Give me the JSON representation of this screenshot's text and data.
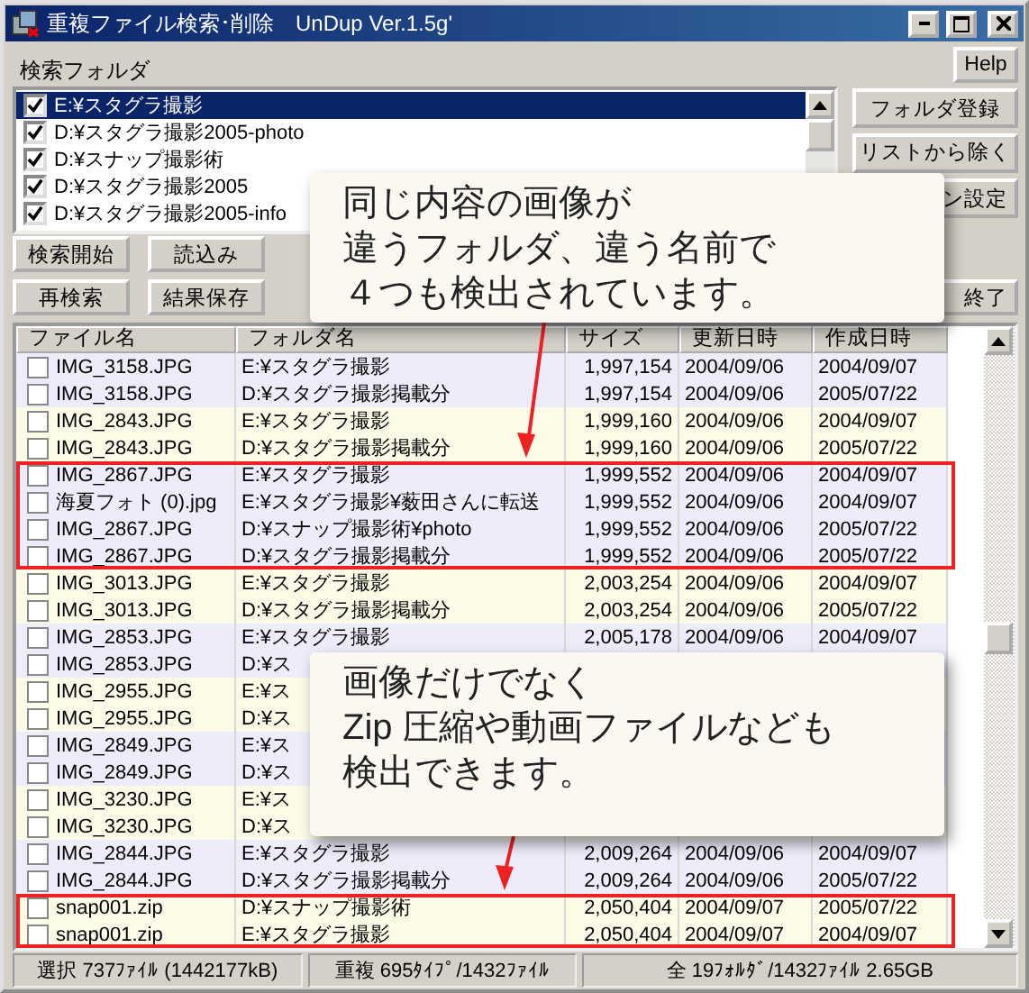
{
  "window": {
    "title": "重複ファイル検索･削除　UnDup Ver.1.5g'"
  },
  "folder_label": "検索フォルダ",
  "help_button": "Help",
  "folders": [
    {
      "path": "E:¥スタグラ撮影",
      "checked": true,
      "selected": true
    },
    {
      "path": "D:¥スタグラ撮影2005-photo",
      "checked": true,
      "selected": false
    },
    {
      "path": "D:¥スナップ撮影術",
      "checked": true,
      "selected": false
    },
    {
      "path": "D:¥スタグラ撮影2005",
      "checked": true,
      "selected": false
    },
    {
      "path": "D:¥スタグラ撮影2005-info",
      "checked": true,
      "selected": false
    }
  ],
  "folder_buttons": [
    {
      "label": "フォルダ登録"
    },
    {
      "label": "リストから除く"
    },
    {
      "label": "ン設定"
    }
  ],
  "action_buttons": [
    [
      "検索開始",
      "読込み"
    ],
    [
      "再検索",
      "結果保存"
    ]
  ],
  "exit_button": "終了",
  "table": {
    "columns": [
      "ファイル名",
      "フォルダ名",
      "サイズ",
      "更新日時",
      "作成日時"
    ],
    "rows": [
      {
        "name": "IMG_3158.JPG",
        "folder": "E:¥スタグラ撮影",
        "size": "1,997,154",
        "modified": "2004/09/06",
        "created": "2004/09/07",
        "checked": false,
        "color": "#ececfa",
        "highlighted": false
      },
      {
        "name": "IMG_3158.JPG",
        "folder": "D:¥スタグラ撮影掲載分",
        "size": "1,997,154",
        "modified": "2004/09/06",
        "created": "2005/07/22",
        "checked": false,
        "color": "#ececfa",
        "highlighted": false
      },
      {
        "name": "IMG_2843.JPG",
        "folder": "E:¥スタグラ撮影",
        "size": "1,999,160",
        "modified": "2004/09/06",
        "created": "2004/09/07",
        "checked": false,
        "color": "#fbfbe8",
        "highlighted": false
      },
      {
        "name": "IMG_2843.JPG",
        "folder": "D:¥スタグラ撮影掲載分",
        "size": "1,999,160",
        "modified": "2004/09/06",
        "created": "2005/07/22",
        "checked": false,
        "color": "#fbfbe8",
        "highlighted": false
      },
      {
        "name": "IMG_2867.JPG",
        "folder": "E:¥スタグラ撮影",
        "size": "1,999,552",
        "modified": "2004/09/06",
        "created": "2004/09/07",
        "checked": false,
        "color": "#ececfa",
        "highlighted": true
      },
      {
        "name": "海夏フォト (0).jpg",
        "folder": "E:¥スタグラ撮影¥薮田さんに転送",
        "size": "1,999,552",
        "modified": "2004/09/06",
        "created": "2004/09/07",
        "checked": false,
        "color": "#ececfa",
        "highlighted": true
      },
      {
        "name": "IMG_2867.JPG",
        "folder": "D:¥スナップ撮影術¥photo",
        "size": "1,999,552",
        "modified": "2004/09/06",
        "created": "2005/07/22",
        "checked": false,
        "color": "#ececfa",
        "highlighted": true
      },
      {
        "name": "IMG_2867.JPG",
        "folder": "D:¥スタグラ撮影掲載分",
        "size": "1,999,552",
        "modified": "2004/09/06",
        "created": "2005/07/22",
        "checked": false,
        "color": "#ececfa",
        "highlighted": true
      },
      {
        "name": "IMG_3013.JPG",
        "folder": "E:¥スタグラ撮影",
        "size": "2,003,254",
        "modified": "2004/09/06",
        "created": "2004/09/07",
        "checked": false,
        "color": "#fbfbe8",
        "highlighted": false
      },
      {
        "name": "IMG_3013.JPG",
        "folder": "D:¥スタグラ撮影掲載分",
        "size": "2,003,254",
        "modified": "2004/09/06",
        "created": "2005/07/22",
        "checked": false,
        "color": "#fbfbe8",
        "highlighted": false
      },
      {
        "name": "IMG_2853.JPG",
        "folder": "E:¥スタグラ撮影",
        "size": "2,005,178",
        "modified": "2004/09/06",
        "created": "2004/09/07",
        "checked": false,
        "color": "#ececfa",
        "highlighted": false
      },
      {
        "name": "IMG_2853.JPG",
        "folder": "D:¥ス",
        "checked": false,
        "color": "#ececfa",
        "highlighted": false
      },
      {
        "name": "IMG_2955.JPG",
        "folder": "E:¥ス",
        "checked": false,
        "color": "#fbfbe8",
        "highlighted": false
      },
      {
        "name": "IMG_2955.JPG",
        "folder": "D:¥ス",
        "checked": false,
        "color": "#fbfbe8",
        "highlighted": false
      },
      {
        "name": "IMG_2849.JPG",
        "folder": "E:¥ス",
        "checked": false,
        "color": "#ececfa",
        "highlighted": false
      },
      {
        "name": "IMG_2849.JPG",
        "folder": "D:¥ス",
        "checked": false,
        "color": "#ececfa",
        "highlighted": false
      },
      {
        "name": "IMG_3230.JPG",
        "folder": "E:¥ス",
        "checked": false,
        "color": "#fbfbe8",
        "highlighted": false
      },
      {
        "name": "IMG_3230.JPG",
        "folder": "D:¥ス",
        "checked": false,
        "color": "#fbfbe8",
        "highlighted": false
      },
      {
        "name": "IMG_2844.JPG",
        "folder": "E:¥スタグラ撮影",
        "size": "2,009,264",
        "modified": "2004/09/06",
        "created": "2004/09/07",
        "checked": false,
        "color": "#ececfa",
        "highlighted": false
      },
      {
        "name": "IMG_2844.JPG",
        "folder": "D:¥スタグラ撮影掲載分",
        "size": "2,009,264",
        "modified": "2004/09/06",
        "created": "2005/07/22",
        "checked": false,
        "color": "#ececfa",
        "highlighted": false
      },
      {
        "name": "snap001.zip",
        "folder": "D:¥スナップ撮影術",
        "size": "2,050,404",
        "modified": "2004/09/07",
        "created": "2005/07/22",
        "checked": false,
        "color": "#fbfbe8",
        "highlighted": true
      },
      {
        "name": "snap001.zip",
        "folder": "E:¥スタグラ撮影",
        "size": "2,050,404",
        "modified": "2004/09/07",
        "created": "2004/09/07",
        "checked": false,
        "color": "#fbfbe8",
        "highlighted": true
      }
    ]
  },
  "status_bar": [
    "選択 737ﾌｧｲﾙ (1442177kB)",
    "重複 695ﾀｲﾌﾟ/1432ﾌｧｲﾙ",
    "全 19ﾌｫﾙﾀﾞ/1432ﾌｧｲﾙ 2.65GB"
  ],
  "callouts": [
    {
      "lines": [
        "同じ内容の画像が",
        "違うフォルダ、違う名前で",
        "４つも検出されています。"
      ]
    },
    {
      "lines": [
        "画像だけでなく",
        "Zip 圧縮や動画ファイルなども",
        "検出できます。"
      ]
    }
  ]
}
